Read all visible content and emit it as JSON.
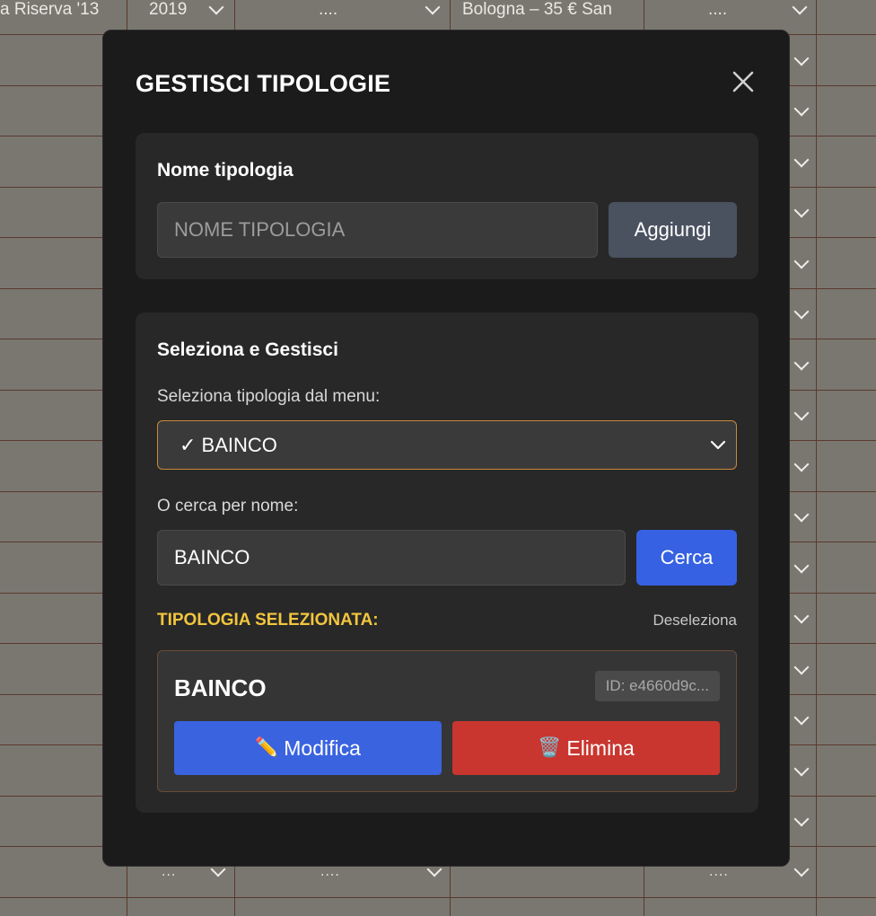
{
  "background": {
    "row_texts": {
      "wine": "a Riserva '13",
      "year": "2019",
      "dots": "....",
      "location": "Bologna – 35 € San"
    },
    "footer_cells": [
      "...",
      "....",
      "...."
    ]
  },
  "modal": {
    "title": "GESTISCI TIPOLOGIE",
    "close_icon": "close-icon",
    "add_section": {
      "title": "Nome tipologia",
      "input_placeholder": "NOME TIPOLOGIA",
      "input_value": "",
      "add_label": "Aggiungi"
    },
    "manage_section": {
      "title": "Seleziona e Gestisci",
      "select_label": "Seleziona tipologia dal menu:",
      "select_value": "✓ BAINCO",
      "search_label": "O cerca per nome:",
      "search_value": "BAINCO",
      "search_button": "Cerca",
      "selected_label": "TIPOLOGIA SELEZIONATA:",
      "deselect_label": "Deseleziona",
      "selected": {
        "name": "BAINCO",
        "id": "ID: e4660d9c...",
        "edit_icon": "✏️",
        "edit_label": "Modifica",
        "delete_icon": "🗑️",
        "delete_label": "Elimina"
      }
    }
  },
  "colors": {
    "accent_blue": "#3661e2",
    "danger_red": "#c9362f",
    "highlight_yellow": "#f2c53d",
    "select_border": "#c9893a"
  }
}
